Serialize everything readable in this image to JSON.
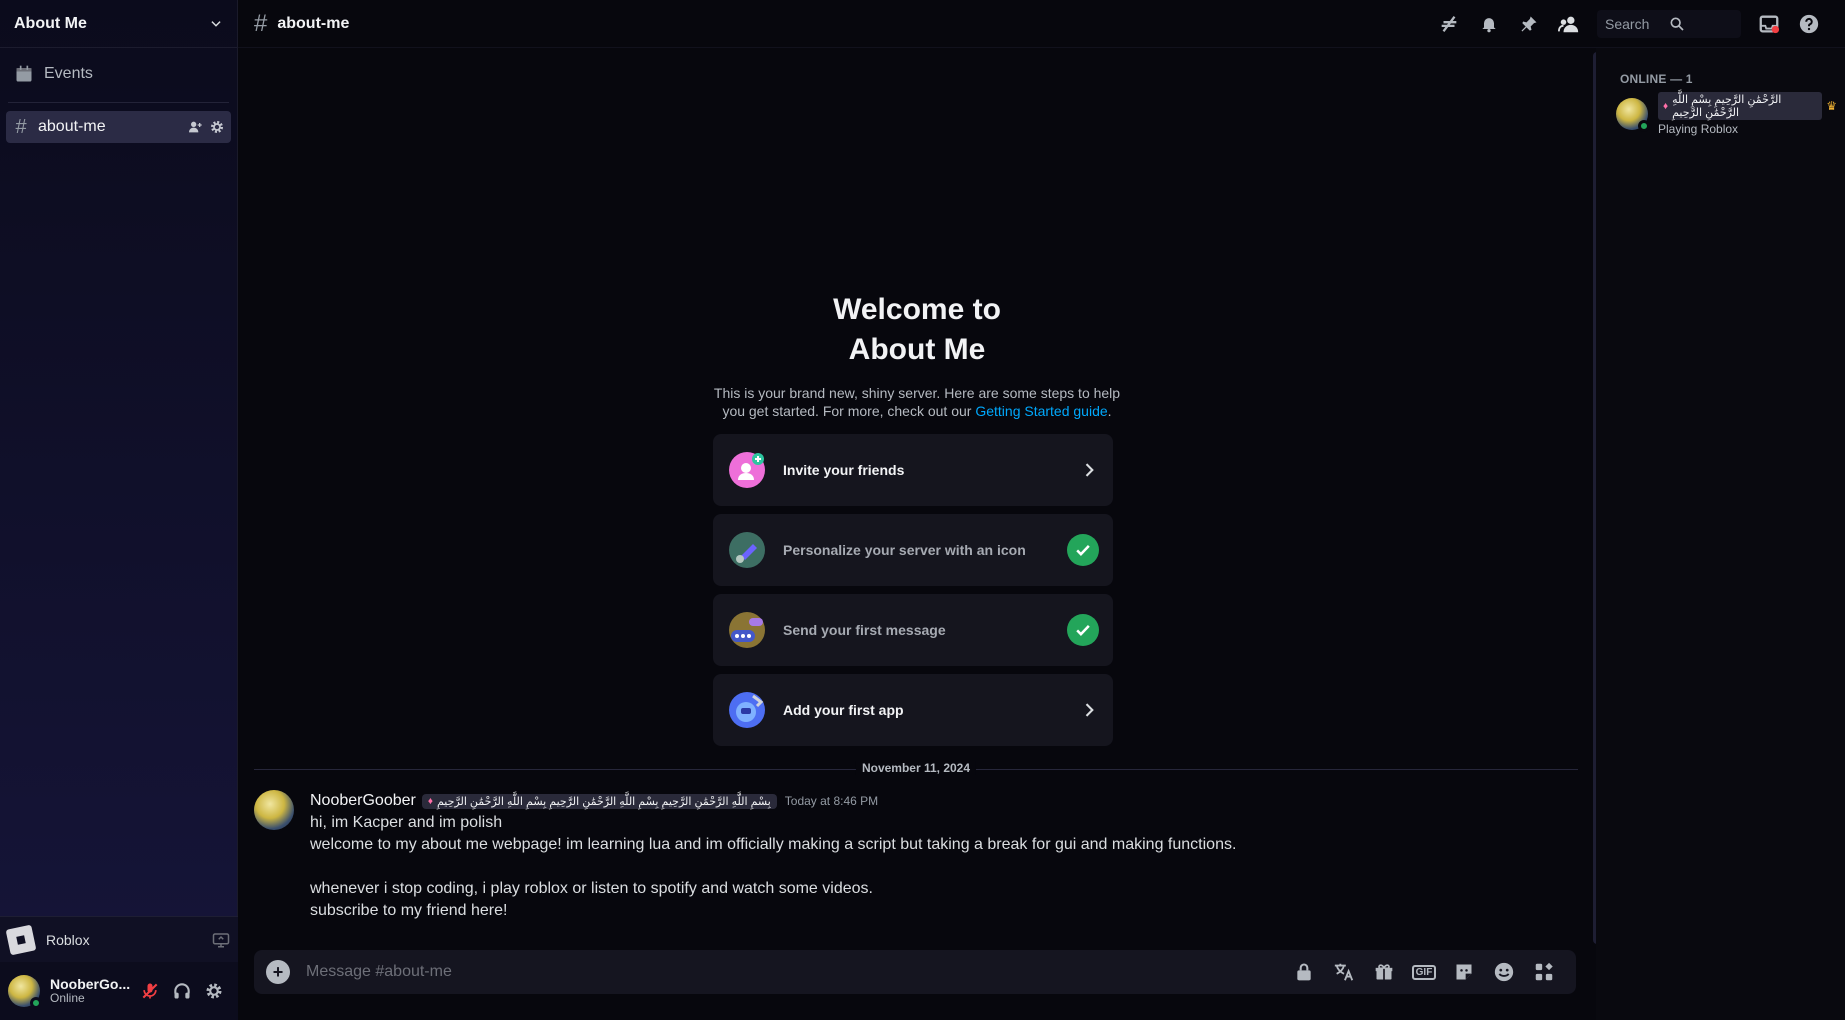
{
  "server": {
    "name": "About Me"
  },
  "sidebar": {
    "events_label": "Events",
    "channels": [
      {
        "name": "about-me"
      }
    ]
  },
  "activity": {
    "game": "Roblox"
  },
  "user": {
    "name": "NooberGo...",
    "status": "Online"
  },
  "topbar": {
    "channel": "about-me",
    "search_placeholder": "Search"
  },
  "welcome": {
    "title_line1": "Welcome to",
    "title_line2": "About Me",
    "desc_line1": "This is your brand new, shiny server. Here are some steps to help",
    "desc_line2_prefix": "you get started. For more, check out our ",
    "guide_link": "Getting Started guide",
    "desc_line2_suffix": "."
  },
  "cards": [
    {
      "label": "Invite your friends",
      "done": false
    },
    {
      "label": "Personalize your server with an icon",
      "done": true
    },
    {
      "label": "Send your first message",
      "done": true
    },
    {
      "label": "Add your first app",
      "done": false
    }
  ],
  "divider_date": "November 11, 2024",
  "message": {
    "author": "NooberGoober",
    "tag": "بِسْمِ اللَّهِ الرَّحْمَٰنِ الرَّحِيمِ بِسْمِ اللَّهِ الرَّحْمَٰنِ الرَّحِيمِ بِسْمِ اللَّهِ الرَّحْمَٰنِ الرَّحِيمِ",
    "time": "Today at 8:46 PM",
    "lines": [
      "hi, im Kacper and im polish",
      "welcome to my about me webpage! im learning lua and im officially making a script but taking a break for gui and making functions.",
      "whenever i stop coding, i play roblox or listen to spotify and watch some videos.",
      "subscribe to my friend here!"
    ]
  },
  "composer": {
    "placeholder": "Message #about-me",
    "gif_label": "GIF"
  },
  "members": {
    "header": "ONLINE — 1",
    "list": [
      {
        "name": "الرَّحْمَٰنِ الرَّحِيمِ بِسْمِ اللَّهِ الرَّحْمَٰنِ الرَّحِيمِ",
        "activity": "Playing Roblox"
      }
    ]
  },
  "colors": {
    "accent_link": "#00a8fc",
    "online": "#23a55a",
    "check": "#23a55a"
  }
}
